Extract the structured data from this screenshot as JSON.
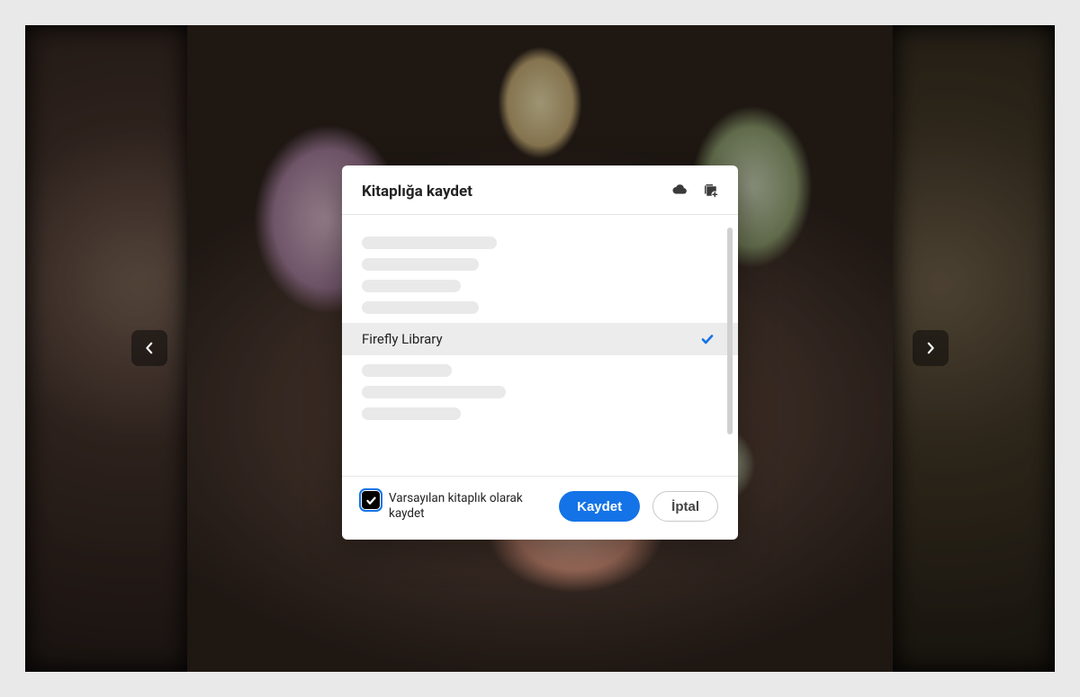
{
  "modal": {
    "title": "Kitaplığa kaydet",
    "selected_library": "Firefly Library",
    "default_checkbox_label": "Varsayılan kitaplık olarak kaydet",
    "default_checkbox_checked": true,
    "save_label": "Kaydet",
    "cancel_label": "İptal"
  }
}
